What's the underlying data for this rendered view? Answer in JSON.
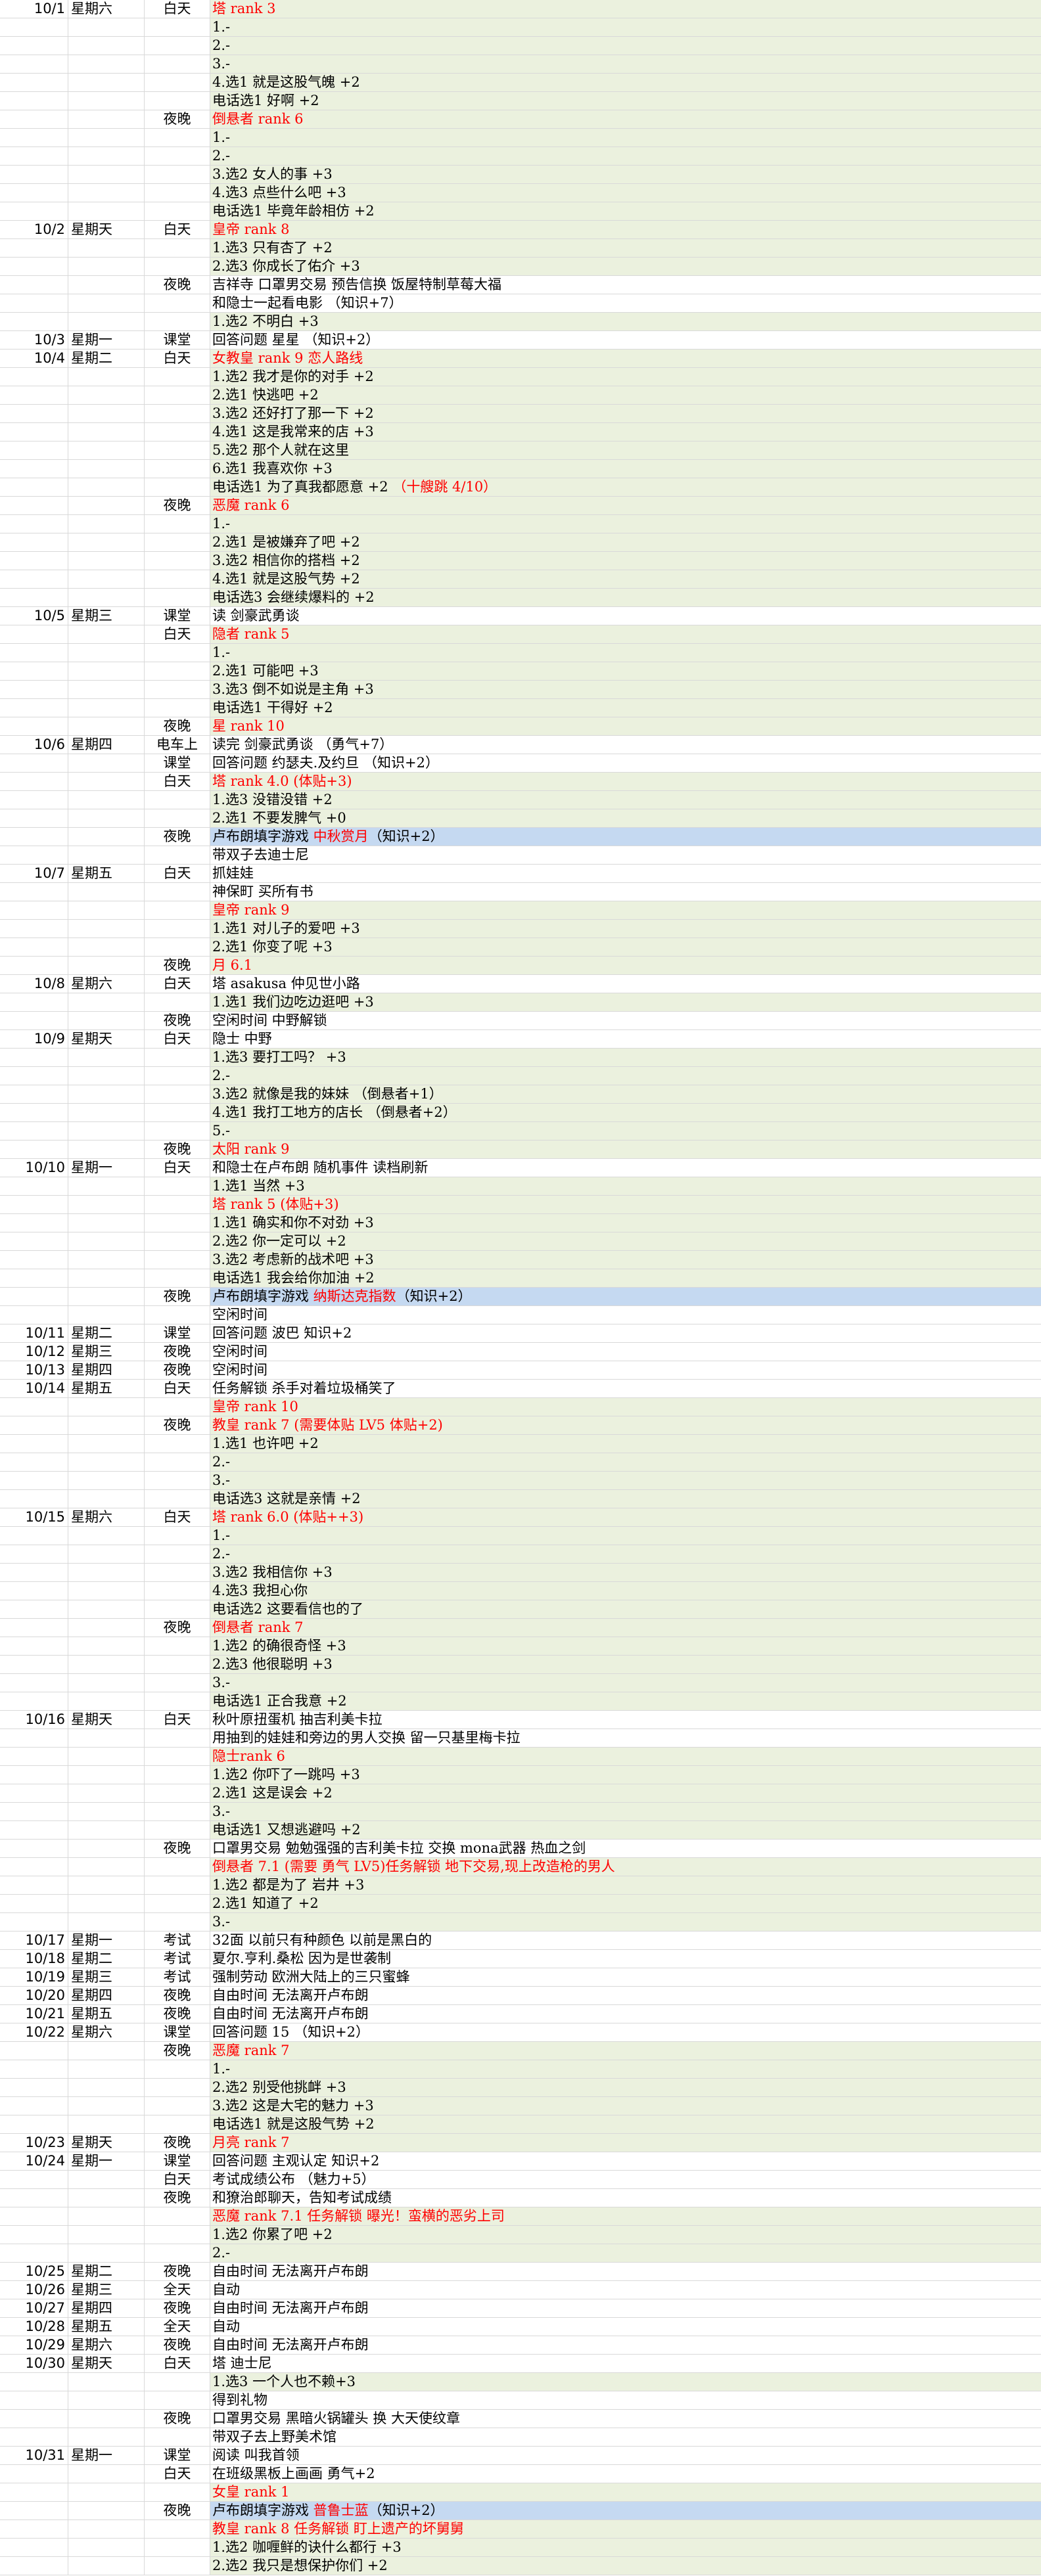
{
  "rows": [
    {
      "date": "10/1",
      "week": "星期六",
      "period": "白天",
      "content": "塔 rank 3",
      "color": "red",
      "bg": "green"
    },
    {
      "date": "",
      "week": "",
      "period": "",
      "content": "1.-",
      "bg": "green"
    },
    {
      "date": "",
      "week": "",
      "period": "",
      "content": "2.-",
      "bg": "green"
    },
    {
      "date": "",
      "week": "",
      "period": "",
      "content": "3.-",
      "bg": "green"
    },
    {
      "date": "",
      "week": "",
      "period": "",
      "content": "4.选1 就是这股气魄 +2",
      "bg": "green"
    },
    {
      "date": "",
      "week": "",
      "period": "",
      "content": "电话选1 好啊 +2",
      "bg": "green"
    },
    {
      "date": "",
      "week": "",
      "period": "夜晚",
      "content": "倒悬者 rank 6",
      "color": "red",
      "bg": "green"
    },
    {
      "date": "",
      "week": "",
      "period": "",
      "content": "1.-",
      "bg": "green"
    },
    {
      "date": "",
      "week": "",
      "period": "",
      "content": "2.-",
      "bg": "green"
    },
    {
      "date": "",
      "week": "",
      "period": "",
      "content": "3.选2 女人的事 +3",
      "bg": "green"
    },
    {
      "date": "",
      "week": "",
      "period": "",
      "content": "4.选3 点些什么吧 +3",
      "bg": "green"
    },
    {
      "date": "",
      "week": "",
      "period": "",
      "content": "电话选1 毕竟年龄相仿 +2",
      "bg": "green"
    },
    {
      "date": "10/2",
      "week": "星期天",
      "period": "白天",
      "content": "皇帝 rank 8",
      "color": "red",
      "bg": "green"
    },
    {
      "date": "",
      "week": "",
      "period": "",
      "content": "1.选3 只有杏了 +2",
      "bg": "green"
    },
    {
      "date": "",
      "week": "",
      "period": "",
      "content": "2.选3 你成长了佑介 +3",
      "bg": "green"
    },
    {
      "date": "",
      "week": "",
      "period": "夜晚",
      "content": "吉祥寺 口罩男交易 预告信换 饭屋特制草莓大福",
      "bg": "none"
    },
    {
      "date": "",
      "week": "",
      "period": "",
      "content": "和隐士一起看电影 （知识+7）",
      "bg": "none"
    },
    {
      "date": "",
      "week": "",
      "period": "",
      "content": "1.选2 不明白 +3",
      "bg": "green"
    },
    {
      "date": "10/3",
      "week": "星期一",
      "period": "课堂",
      "content": "回答问题 星星 （知识+2）",
      "bg": "none"
    },
    {
      "date": "10/4",
      "week": "星期二",
      "period": "白天",
      "content": "女教皇 rank 9 恋人路线",
      "color": "red",
      "bg": "green"
    },
    {
      "date": "",
      "week": "",
      "period": "",
      "content": "1.选2 我才是你的对手 +2",
      "bg": "green"
    },
    {
      "date": "",
      "week": "",
      "period": "",
      "content": "2.选1 快逃吧 +2",
      "bg": "green"
    },
    {
      "date": "",
      "week": "",
      "period": "",
      "content": "3.选2 还好打了那一下 +2",
      "bg": "green"
    },
    {
      "date": "",
      "week": "",
      "period": "",
      "content": "4.选1 这是我常来的店 +3",
      "bg": "green"
    },
    {
      "date": "",
      "week": "",
      "period": "",
      "content": "5.选2 那个人就在这里",
      "bg": "green"
    },
    {
      "date": "",
      "week": "",
      "period": "",
      "content": "6.选1 我喜欢你 +3",
      "bg": "green"
    },
    {
      "date": "",
      "week": "",
      "period": "",
      "content": "电话选1 为了真我都愿意 +2",
      "extra": " （十艘跳 4/10）",
      "bg": "green"
    },
    {
      "date": "",
      "week": "",
      "period": "夜晚",
      "content": "恶魔 rank 6",
      "color": "red",
      "bg": "green"
    },
    {
      "date": "",
      "week": "",
      "period": "",
      "content": "1.-",
      "bg": "green"
    },
    {
      "date": "",
      "week": "",
      "period": "",
      "content": "2.选1 是被嫌弃了吧 +2",
      "bg": "green"
    },
    {
      "date": "",
      "week": "",
      "period": "",
      "content": "3.选2 相信你的搭档 +2",
      "bg": "green"
    },
    {
      "date": "",
      "week": "",
      "period": "",
      "content": "4.选1 就是这股气势 +2",
      "bg": "green"
    },
    {
      "date": "",
      "week": "",
      "period": "",
      "content": "电话选3 会继续爆料的 +2",
      "bg": "green"
    },
    {
      "date": "10/5",
      "week": "星期三",
      "period": "课堂",
      "content": "读 剑豪武勇谈",
      "bg": "none"
    },
    {
      "date": "",
      "week": "",
      "period": "白天",
      "content": "隐者 rank 5",
      "color": "red",
      "bg": "green"
    },
    {
      "date": "",
      "week": "",
      "period": "",
      "content": "1.-",
      "bg": "green"
    },
    {
      "date": "",
      "week": "",
      "period": "",
      "content": "2.选1 可能吧 +3",
      "bg": "green"
    },
    {
      "date": "",
      "week": "",
      "period": "",
      "content": "3.选3 倒不如说是主角 +3",
      "bg": "green"
    },
    {
      "date": "",
      "week": "",
      "period": "",
      "content": "电话选1 干得好 +2",
      "bg": "green"
    },
    {
      "date": "",
      "week": "",
      "period": "夜晚",
      "content": "星 rank 10",
      "color": "red",
      "bg": "green"
    },
    {
      "date": "10/6",
      "week": "星期四",
      "period": "电车上",
      "content": "读完 剑豪武勇谈 （勇气+7）",
      "bg": "none"
    },
    {
      "date": "",
      "week": "",
      "period": "课堂",
      "content": "回答问题 约瑟夫.及约旦 （知识+2）",
      "bg": "none"
    },
    {
      "date": "",
      "week": "",
      "period": "白天",
      "content": "塔 rank 4.0 (体贴+3)",
      "color": "red",
      "bg": "green"
    },
    {
      "date": "",
      "week": "",
      "period": "",
      "content": "1.选3 没错没错 +2",
      "bg": "green"
    },
    {
      "date": "",
      "week": "",
      "period": "",
      "content": "2.选1 不要发脾气 +0",
      "bg": "green"
    },
    {
      "date": "",
      "week": "",
      "period": "夜晚",
      "content": "卢布朗填字游戏",
      "extra": " 中秋赏月",
      "extra_color": "red",
      "content2": "（知识+2）",
      "bg": "blue"
    },
    {
      "date": "",
      "week": "",
      "period": "",
      "content": "带双子去迪士尼",
      "bg": "none"
    },
    {
      "date": "10/7",
      "week": "星期五",
      "period": "白天",
      "content": "抓娃娃",
      "bg": "none"
    },
    {
      "date": "",
      "week": "",
      "period": "",
      "content": "神保町 买所有书",
      "bg": "none"
    },
    {
      "date": "",
      "week": "",
      "period": "",
      "content": "皇帝 rank 9",
      "color": "red",
      "bg": "green"
    },
    {
      "date": "",
      "week": "",
      "period": "",
      "content": "1.选1 对儿子的爱吧 +3",
      "bg": "green"
    },
    {
      "date": "",
      "week": "",
      "period": "",
      "content": "2.选1 你变了呢 +3",
      "bg": "green"
    },
    {
      "date": "",
      "week": "",
      "period": "夜晚",
      "content": "月 6.1",
      "color": "red",
      "bg": "green"
    },
    {
      "date": "10/8",
      "week": "星期六",
      "period": "白天",
      "content": "塔 asakusa 仲见世小路",
      "bg": "none"
    },
    {
      "date": "",
      "week": "",
      "period": "",
      "content": "1.选1 我们边吃边逛吧 +3",
      "bg": "green"
    },
    {
      "date": "",
      "week": "",
      "period": "夜晚",
      "content": "空闲时间 中野解锁",
      "bg": "none"
    },
    {
      "date": "10/9",
      "week": "星期天",
      "period": "白天",
      "content": "隐士 中野",
      "bg": "none"
    },
    {
      "date": "",
      "week": "",
      "period": "",
      "content": "1.选3 要打工吗？ +3",
      "bg": "green"
    },
    {
      "date": "",
      "week": "",
      "period": "",
      "content": "2.-",
      "bg": "green"
    },
    {
      "date": "",
      "week": "",
      "period": "",
      "content": "3.选2 就像是我的妹妹 （倒悬者+1）",
      "bg": "green"
    },
    {
      "date": "",
      "week": "",
      "period": "",
      "content": "4.选1 我打工地方的店长 （倒悬者+2）",
      "bg": "green"
    },
    {
      "date": "",
      "week": "",
      "period": "",
      "content": "5.-",
      "bg": "green"
    },
    {
      "date": "",
      "week": "",
      "period": "夜晚",
      "content": "太阳 rank 9",
      "color": "red",
      "bg": "green"
    },
    {
      "date": "10/10",
      "week": "星期一",
      "period": "白天",
      "content": "和隐士在卢布朗 随机事件 读档刷新",
      "bg": "none"
    },
    {
      "date": "",
      "week": "",
      "period": "",
      "content": "1.选1 当然 +3",
      "bg": "green"
    },
    {
      "date": "",
      "week": "",
      "period": "",
      "content": "塔 rank 5 (体贴+3)",
      "color": "red",
      "bg": "green"
    },
    {
      "date": "",
      "week": "",
      "period": "",
      "content": "1.选1 确实和你不对劲 +3",
      "bg": "green"
    },
    {
      "date": "",
      "week": "",
      "period": "",
      "content": "2.选2 你一定可以 +2",
      "bg": "green"
    },
    {
      "date": "",
      "week": "",
      "period": "",
      "content": "3.选2 考虑新的战术吧 +3",
      "bg": "green"
    },
    {
      "date": "",
      "week": "",
      "period": "",
      "content": "电话选1 我会给你加油 +2",
      "bg": "green"
    },
    {
      "date": "",
      "week": "",
      "period": "夜晚",
      "content": "卢布朗填字游戏",
      "extra": " 纳斯达克指数",
      "extra_color": "red",
      "content2": "（知识+2）",
      "bg": "blue"
    },
    {
      "date": "",
      "week": "",
      "period": "",
      "content": "空闲时间",
      "bg": "none"
    },
    {
      "date": "10/11",
      "week": "星期二",
      "period": "课堂",
      "content": "回答问题  波巴 知识+2",
      "bg": "none"
    },
    {
      "date": "10/12",
      "week": "星期三",
      "period": "夜晚",
      "content": "空闲时间",
      "bg": "none"
    },
    {
      "date": "10/13",
      "week": "星期四",
      "period": "夜晚",
      "content": "空闲时间",
      "bg": "none"
    },
    {
      "date": "10/14",
      "week": "星期五",
      "period": "白天",
      "content": "任务解锁 杀手对着垃圾桶笑了",
      "bg": "none"
    },
    {
      "date": "",
      "week": "",
      "period": "",
      "content": "皇帝 rank 10",
      "color": "red",
      "bg": "green"
    },
    {
      "date": "",
      "week": "",
      "period": "夜晚",
      "content": "教皇 rank 7 (需要体贴 LV5 体贴+2)",
      "color": "red",
      "bg": "green"
    },
    {
      "date": "",
      "week": "",
      "period": "",
      "content": "1.选1 也许吧 +2",
      "bg": "green"
    },
    {
      "date": "",
      "week": "",
      "period": "",
      "content": "2.-",
      "bg": "green"
    },
    {
      "date": "",
      "week": "",
      "period": "",
      "content": "3.-",
      "bg": "green"
    },
    {
      "date": "",
      "week": "",
      "period": "",
      "content": "电话选3 这就是亲情 +2",
      "bg": "green"
    },
    {
      "date": "10/15",
      "week": "星期六",
      "period": "白天",
      "content": "塔 rank 6.0 (体贴++3)",
      "color": "red",
      "bg": "green"
    },
    {
      "date": "",
      "week": "",
      "period": "",
      "content": "1.-",
      "bg": "green"
    },
    {
      "date": "",
      "week": "",
      "period": "",
      "content": "2.-",
      "bg": "green"
    },
    {
      "date": "",
      "week": "",
      "period": "",
      "content": "3.选2 我相信你 +3",
      "bg": "green"
    },
    {
      "date": "",
      "week": "",
      "period": "",
      "content": "4.选3 我担心你",
      "bg": "green"
    },
    {
      "date": "",
      "week": "",
      "period": "",
      "content": "电话选2 这要看信也的了",
      "bg": "green"
    },
    {
      "date": "",
      "week": "",
      "period": "夜晚",
      "content": "倒悬者 rank 7",
      "color": "red",
      "bg": "green"
    },
    {
      "date": "",
      "week": "",
      "period": "",
      "content": "1.选2 的确很奇怪 +3",
      "bg": "green"
    },
    {
      "date": "",
      "week": "",
      "period": "",
      "content": "2.选3 他很聪明 +3",
      "bg": "green"
    },
    {
      "date": "",
      "week": "",
      "period": "",
      "content": "3.-",
      "bg": "green"
    },
    {
      "date": "",
      "week": "",
      "period": "",
      "content": "电话选1 正合我意 +2",
      "bg": "green"
    },
    {
      "date": "10/16",
      "week": "星期天",
      "period": "白天",
      "content": "秋叶原扭蛋机 抽吉利美卡拉",
      "bg": "none"
    },
    {
      "date": "",
      "week": "",
      "period": "",
      "content": "用抽到的娃娃和旁边的男人交换 留一只基里梅卡拉",
      "bg": "none"
    },
    {
      "date": "",
      "week": "",
      "period": "",
      "content": "隐士rank 6",
      "color": "red",
      "bg": "green"
    },
    {
      "date": "",
      "week": "",
      "period": "",
      "content": "1.选2 你吓了一跳吗 +3",
      "bg": "green"
    },
    {
      "date": "",
      "week": "",
      "period": "",
      "content": "2.选1 这是误会 +2",
      "bg": "green"
    },
    {
      "date": "",
      "week": "",
      "period": "",
      "content": "3.-",
      "bg": "green"
    },
    {
      "date": "",
      "week": "",
      "period": "",
      "content": "电话选1 又想逃避吗 +2",
      "bg": "green"
    },
    {
      "date": "",
      "week": "",
      "period": "夜晚",
      "content": "口罩男交易 勉勉强强的吉利美卡拉 交换 mona武器 热血之剑",
      "bg": "none"
    },
    {
      "date": "",
      "week": "",
      "period": "",
      "content": "倒悬者 7.1 (需要 勇气 LV5)任务解锁 地下交易,现上改造枪的男人",
      "color": "red",
      "bg": "green"
    },
    {
      "date": "",
      "week": "",
      "period": "",
      "content": "1.选2 都是为了 岩井 +3",
      "bg": "green"
    },
    {
      "date": "",
      "week": "",
      "period": "",
      "content": "2.选1 知道了 +2",
      "bg": "green"
    },
    {
      "date": "",
      "week": "",
      "period": "",
      "content": "3.-",
      "bg": "green"
    },
    {
      "date": "10/17",
      "week": "星期一",
      "period": "考试",
      "content": "32面 以前只有种颜色 以前是黑白的",
      "bg": "none"
    },
    {
      "date": "10/18",
      "week": "星期二",
      "period": "考试",
      "content": "夏尔.亨利.桑松 因为是世袭制",
      "bg": "none"
    },
    {
      "date": "10/19",
      "week": "星期三",
      "period": "考试",
      "content": "强制劳动 欧洲大陆上的三只蜜蜂",
      "bg": "none"
    },
    {
      "date": "10/20",
      "week": "星期四",
      "period": "夜晚",
      "content": "自由时间 无法离开卢布朗",
      "bg": "none"
    },
    {
      "date": "10/21",
      "week": "星期五",
      "period": "夜晚",
      "content": "自由时间 无法离开卢布朗",
      "bg": "none"
    },
    {
      "date": "10/22",
      "week": "星期六",
      "period": "课堂",
      "content": "回答问题 15 （知识+2）",
      "bg": "none"
    },
    {
      "date": "",
      "week": "",
      "period": "夜晚",
      "content": "恶魔 rank 7",
      "color": "red",
      "bg": "green"
    },
    {
      "date": "",
      "week": "",
      "period": "",
      "content": "1.-",
      "bg": "green"
    },
    {
      "date": "",
      "week": "",
      "period": "",
      "content": "2.选2 别受他挑衅 +3",
      "bg": "green"
    },
    {
      "date": "",
      "week": "",
      "period": "",
      "content": "3.选2 这是大宅的魅力 +3",
      "bg": "green"
    },
    {
      "date": "",
      "week": "",
      "period": "",
      "content": "电话选1 就是这股气势 +2",
      "bg": "green"
    },
    {
      "date": "10/23",
      "week": "星期天",
      "period": "夜晚",
      "content": "月亮 rank 7",
      "color": "red",
      "bg": "green"
    },
    {
      "date": "10/24",
      "week": "星期一",
      "period": "课堂",
      "content": "回答问题  主观认定 知识+2",
      "bg": "none"
    },
    {
      "date": "",
      "week": "",
      "period": "白天",
      "content": "考试成绩公布 （魅力+5）",
      "bg": "none"
    },
    {
      "date": "",
      "week": "",
      "period": "夜晚",
      "content": "和獠治郎聊天，告知考试成绩",
      "bg": "none"
    },
    {
      "date": "",
      "week": "",
      "period": "",
      "content": "恶魔 rank 7.1  任务解锁 曝光！蛮横的恶劣上司",
      "color": "red",
      "bg": "green"
    },
    {
      "date": "",
      "week": "",
      "period": "",
      "content": "1.选2 你累了吧 +2",
      "bg": "green"
    },
    {
      "date": "",
      "week": "",
      "period": "",
      "content": "2.-",
      "bg": "green"
    },
    {
      "date": "10/25",
      "week": "星期二",
      "period": "夜晚",
      "content": "自由时间 无法离开卢布朗",
      "bg": "none"
    },
    {
      "date": "10/26",
      "week": "星期三",
      "period": "全天",
      "content": "自动",
      "bg": "none"
    },
    {
      "date": "10/27",
      "week": "星期四",
      "period": "夜晚",
      "content": "自由时间 无法离开卢布朗",
      "bg": "none"
    },
    {
      "date": "10/28",
      "week": "星期五",
      "period": "全天",
      "content": "自动",
      "bg": "none"
    },
    {
      "date": "10/29",
      "week": "星期六",
      "period": "夜晚",
      "content": "自由时间 无法离开卢布朗",
      "bg": "none"
    },
    {
      "date": "10/30",
      "week": "星期天",
      "period": "白天",
      "content": "塔 迪士尼",
      "bg": "none"
    },
    {
      "date": "",
      "week": "",
      "period": "",
      "content": "1.选3 一个人也不赖+3",
      "bg": "green"
    },
    {
      "date": "",
      "week": "",
      "period": "",
      "content": "得到礼物",
      "bg": "none"
    },
    {
      "date": "",
      "week": "",
      "period": "夜晚",
      "content": "口罩男交易 黑暗火锅罐头 换 大天使纹章",
      "bg": "none"
    },
    {
      "date": "",
      "week": "",
      "period": "",
      "content": "带双子去上野美术馆",
      "bg": "none"
    },
    {
      "date": "10/31",
      "week": "星期一",
      "period": "课堂",
      "content": "阅读 叫我首领",
      "bg": "none"
    },
    {
      "date": "",
      "week": "",
      "period": "白天",
      "content": "在班级黑板上画画  勇气+2",
      "bg": "none"
    },
    {
      "date": "",
      "week": "",
      "period": "",
      "content": "女皇 rank 1",
      "color": "red",
      "bg": "green"
    },
    {
      "date": "",
      "week": "",
      "period": "夜晚",
      "content": "卢布朗填字游戏",
      "extra": " 普鲁士蓝",
      "extra_color": "red",
      "content2": "（知识+2）",
      "bg": "blue"
    },
    {
      "date": "",
      "week": "",
      "period": "",
      "content": "教皇 rank 8 任务解锁 盯上遗产的坏舅舅",
      "color": "red",
      "bg": "green"
    },
    {
      "date": "",
      "week": "",
      "period": "",
      "content": "1.选2 咖喱鲜的诀什么都行 +3",
      "bg": "green"
    },
    {
      "date": "",
      "week": "",
      "period": "",
      "content": "2.选2 我只是想保护你们 +2",
      "bg": "green"
    }
  ]
}
